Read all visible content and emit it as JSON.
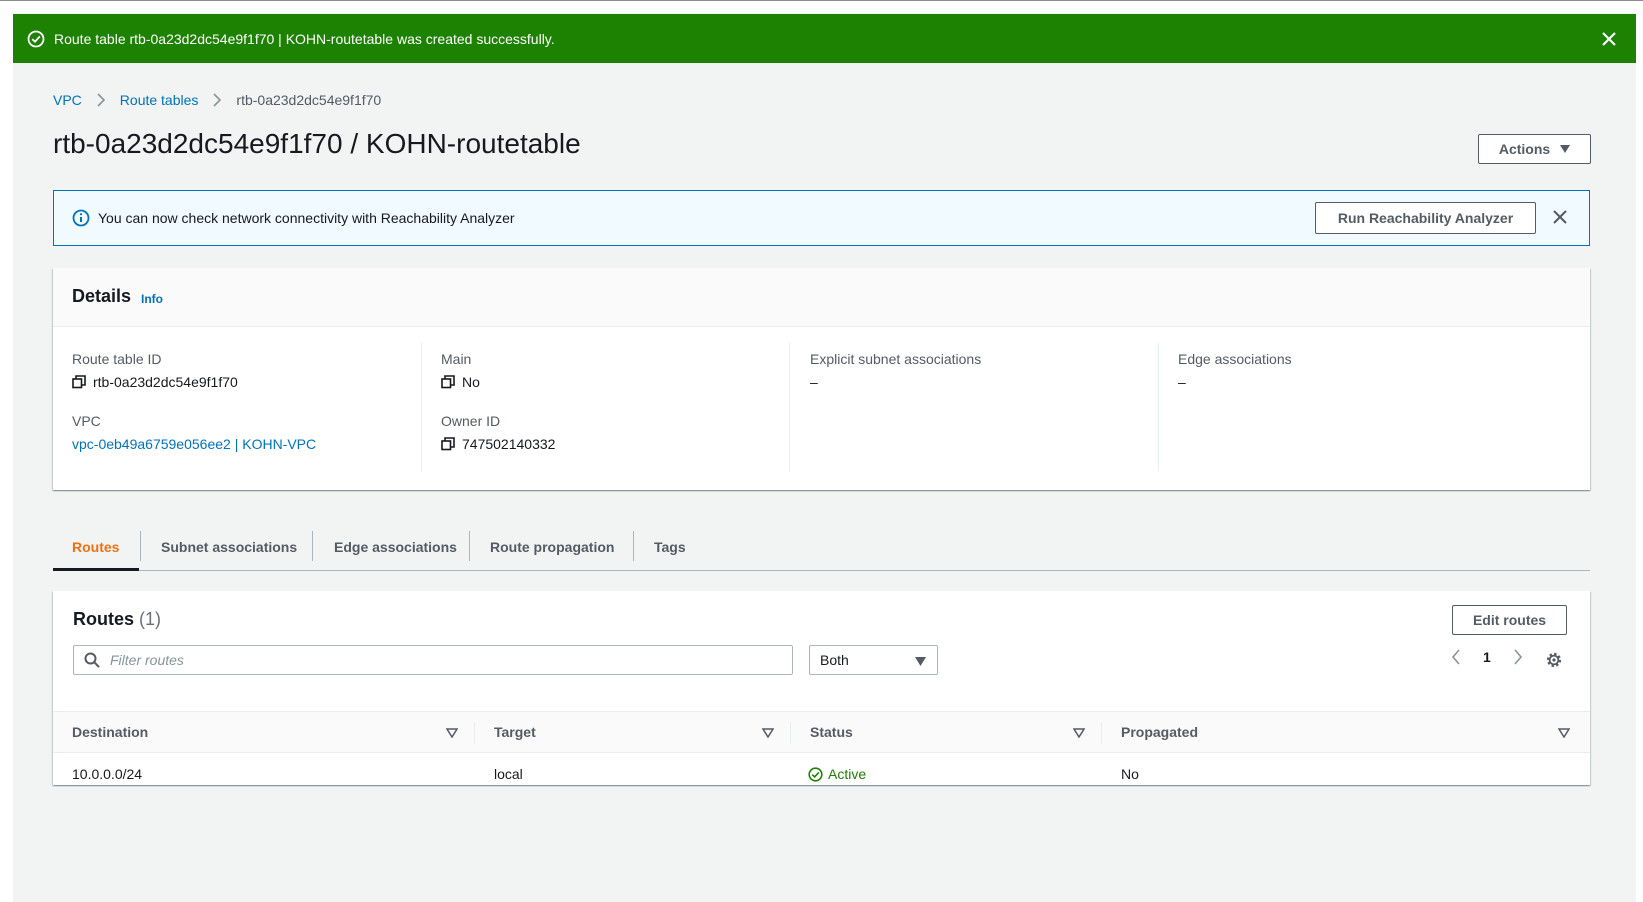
{
  "flash": {
    "message": "Route table rtb-0a23d2dc54e9f1f70 | KOHN-routetable was created successfully.",
    "icon": "check-circle-icon",
    "close_icon": "close-icon",
    "color": "#1d8102"
  },
  "breadcrumb": {
    "items": [
      "VPC",
      "Route tables"
    ],
    "current": "rtb-0a23d2dc54e9f1f70"
  },
  "page": {
    "title": "rtb-0a23d2dc54e9f1f70 / KOHN-routetable",
    "actions_label": "Actions"
  },
  "info_alert": {
    "text": "You can now check network connectivity with Reachability Analyzer",
    "button_label": "Run Reachability Analyzer"
  },
  "details": {
    "heading": "Details",
    "info_link": "Info",
    "route_table_id_label": "Route table ID",
    "route_table_id": "rtb-0a23d2dc54e9f1f70",
    "vpc_label": "VPC",
    "vpc": "vpc-0eb49a6759e056ee2 | KOHN-VPC",
    "main_label": "Main",
    "main": "No",
    "owner_id_label": "Owner ID",
    "owner_id": "747502140332",
    "explicit_subnet_label": "Explicit subnet associations",
    "explicit_subnet": "–",
    "edge_label": "Edge associations",
    "edge": "–"
  },
  "tabs": [
    "Routes",
    "Subnet associations",
    "Edge associations",
    "Route propagation",
    "Tags"
  ],
  "routes": {
    "heading": "Routes",
    "count": "(1)",
    "edit_label": "Edit routes",
    "filter_placeholder": "Filter routes",
    "select_value": "Both",
    "page_number": "1",
    "columns": [
      "Destination",
      "Target",
      "Status",
      "Propagated"
    ],
    "rows": [
      {
        "destination": "10.0.0.0/24",
        "target": "local",
        "status": "Active",
        "propagated": "No"
      }
    ]
  },
  "colors": {
    "link": "#0073bb",
    "active_tab": "#ec7211",
    "success": "#1d8102"
  }
}
